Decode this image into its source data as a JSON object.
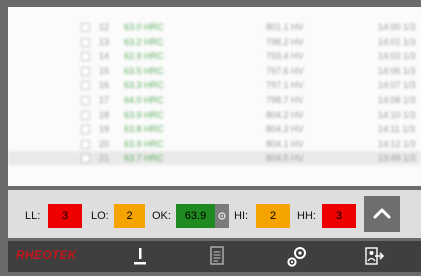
{
  "list": {
    "rows": [
      {
        "num": "12",
        "value": "63.0 HRC",
        "value2": "801.1 HV",
        "time": "14:00 1/3"
      },
      {
        "num": "13",
        "value": "63.2 HRC",
        "value2": "798.2 HV",
        "time": "14:01 1/3"
      },
      {
        "num": "14",
        "value": "62.9 HRC",
        "value2": "793.4 HV",
        "time": "14:03 1/3"
      },
      {
        "num": "15",
        "value": "63.5 HRC",
        "value2": "797.6 HV",
        "time": "14:06 1/3"
      },
      {
        "num": "16",
        "value": "63.3 HRC",
        "value2": "797.1 HV",
        "time": "14:07 1/3"
      },
      {
        "num": "17",
        "value": "64.0 HRC",
        "value2": "798.7 HV",
        "time": "14:08 1/3"
      },
      {
        "num": "18",
        "value": "63.9 HRC",
        "value2": "804.2 HV",
        "time": "14:10 1/3"
      },
      {
        "num": "19",
        "value": "63.8 HRC",
        "value2": "804.3 HV",
        "time": "14:11 1/3"
      },
      {
        "num": "20",
        "value": "63.9 HRC",
        "value2": "804.1 HV",
        "time": "14:12 1/3"
      },
      {
        "num": "21",
        "value": "63.7 HRC",
        "value2": "804.5 HV",
        "time": "13:49 1/3"
      }
    ]
  },
  "limits": {
    "ll_label": "LL:",
    "ll_value": "3",
    "lo_label": "LO:",
    "lo_value": "2",
    "ok_label": "OK:",
    "ok_value": "63.9",
    "hi_label": "HI:",
    "hi_value": "2",
    "hh_label": "HH:",
    "hh_value": "3"
  },
  "brand": {
    "logo_text": "RHEOTEK"
  },
  "icons": {
    "collapse": "chevron-up-icon",
    "probe": "probe-icon",
    "report": "document-icon",
    "settings": "gears-icon",
    "exit": "exit-icon"
  },
  "colors": {
    "alarm": "#ee0000",
    "warning": "#f5a300",
    "ok": "#1f8a1f",
    "nav": "#3f3f3f"
  }
}
